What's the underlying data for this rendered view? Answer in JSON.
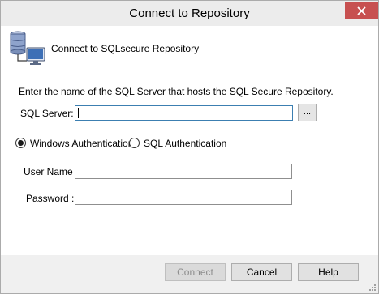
{
  "window": {
    "title": "Connect to Repository"
  },
  "header": {
    "icon": "server-computer-icon",
    "text": "Connect to SQLsecure Repository"
  },
  "form": {
    "instruction": "Enter the name of the SQL Server that hosts the SQL Secure Repository.",
    "sql_server_label": "SQL Server:",
    "sql_server_value": "",
    "browse_label": "...",
    "windows_auth_label": "Windows Authentication",
    "windows_auth_selected": true,
    "sql_auth_label": "SQL Authentication",
    "sql_auth_selected": false,
    "user_name_label": "User Name :",
    "user_name_value": "",
    "password_label": "Password :",
    "password_value": ""
  },
  "buttons": {
    "connect": "Connect",
    "connect_enabled": false,
    "cancel": "Cancel",
    "help": "Help"
  },
  "colors": {
    "close_button": "#c75050",
    "focus_border": "#3c7fb1"
  }
}
